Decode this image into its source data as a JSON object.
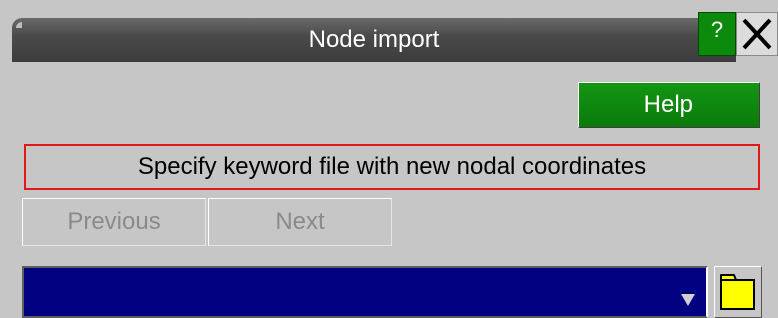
{
  "window": {
    "title": "Node import",
    "help_icon_label": "?",
    "help_icon_color": "#0c8a0c",
    "close_icon": "close-x-icon"
  },
  "actions": {
    "help_label": "Help",
    "help_color": "#0a7a0a"
  },
  "instruction": {
    "text": "Specify keyword file with new nodal coordinates",
    "border_color": "#e01818"
  },
  "navigation": {
    "previous_label": "Previous",
    "next_label": "Next",
    "state": "disabled"
  },
  "file_input": {
    "value": "",
    "background_color": "#000080",
    "dropdown_icon": "dropdown-arrow-icon",
    "browse_icon": "folder-icon",
    "browse_icon_color": "#ffff00"
  }
}
